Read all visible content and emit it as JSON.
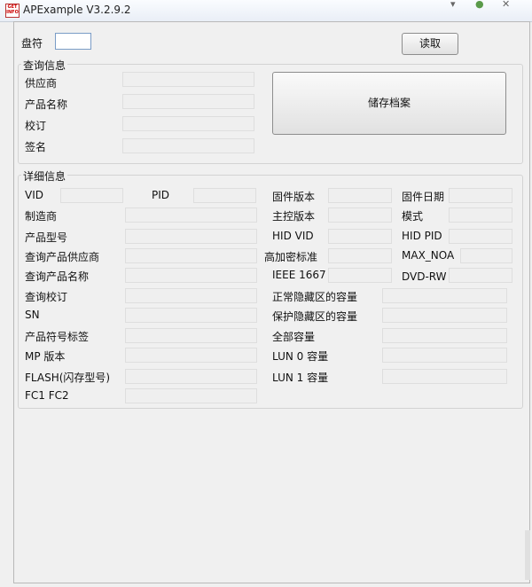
{
  "window": {
    "title": "APExample V3.2.9.2",
    "icon_text": "GET INFO"
  },
  "header": {
    "drive_label": "盘符",
    "drive_value": "",
    "read_button": "读取"
  },
  "query_group": {
    "title": "查询信息",
    "labels": [
      "供应商",
      "产品名称",
      "校订",
      "签名"
    ],
    "save_button": "储存档案"
  },
  "detail_group": {
    "title": "详细信息",
    "vid": "VID",
    "pid": "PID",
    "manufacturer": "制造商",
    "model": "产品型号",
    "query_vendor": "查询产品供应商",
    "query_product": "查询产品名称",
    "query_revision": "查询校订",
    "sn": "SN",
    "serial_tag": "产品符号标签",
    "mp_version": "MP 版本",
    "flash_model": "FLASH(闪存型号)",
    "fc": "FC1 FC2",
    "fw_version": "固件版本",
    "fw_date": "固件日期",
    "controller_version": "主控版本",
    "mode": "模式",
    "hid_vid": "HID VID",
    "hid_pid": "HID PID",
    "encryption": "高加密标准",
    "max_noa": "MAX_NOA",
    "ieee": "IEEE 1667",
    "dvd": "DVD-RW",
    "normal_hidden": "正常隐藏区的容量",
    "protected_hidden": "保护隐藏区的容量",
    "total": "全部容量",
    "lun0": "LUN 0 容量",
    "lun1": "LUN 1 容量"
  }
}
